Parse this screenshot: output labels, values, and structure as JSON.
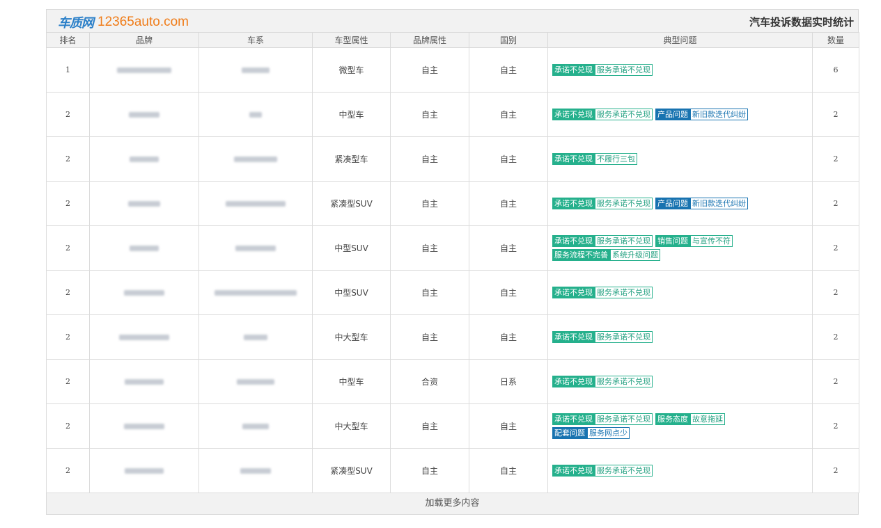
{
  "header": {
    "logo_text": "车质网",
    "logo_url": "12365auto.com",
    "title": "汽车投诉数据实时统计"
  },
  "columns": [
    "排名",
    "品牌",
    "车系",
    "车型属性",
    "品牌属性",
    "国别",
    "典型问题",
    "数量"
  ],
  "rows": [
    {
      "rank": "1",
      "type": "微型车",
      "brand_attr": "自主",
      "country": "自主",
      "count": "6",
      "lines": [
        [
          {
            "text": "承诺不兑现",
            "kind": "cat",
            "color": "green"
          },
          {
            "text": "服务承诺不兑现",
            "kind": "sub",
            "color": "green"
          }
        ]
      ]
    },
    {
      "rank": "2",
      "type": "中型车",
      "brand_attr": "自主",
      "country": "自主",
      "count": "2",
      "lines": [
        [
          {
            "text": "承诺不兑现",
            "kind": "cat",
            "color": "green"
          },
          {
            "text": "服务承诺不兑现",
            "kind": "sub",
            "color": "green"
          },
          {
            "text": "产品问题",
            "kind": "cat",
            "color": "blue"
          },
          {
            "text": "新旧款迭代纠纷",
            "kind": "sub",
            "color": "blue"
          }
        ]
      ]
    },
    {
      "rank": "2",
      "type": "紧凑型车",
      "brand_attr": "自主",
      "country": "自主",
      "count": "2",
      "lines": [
        [
          {
            "text": "承诺不兑现",
            "kind": "cat",
            "color": "green"
          },
          {
            "text": "不履行三包",
            "kind": "sub",
            "color": "green"
          }
        ]
      ]
    },
    {
      "rank": "2",
      "type": "紧凑型SUV",
      "brand_attr": "自主",
      "country": "自主",
      "count": "2",
      "lines": [
        [
          {
            "text": "承诺不兑现",
            "kind": "cat",
            "color": "green"
          },
          {
            "text": "服务承诺不兑现",
            "kind": "sub",
            "color": "green"
          },
          {
            "text": "产品问题",
            "kind": "cat",
            "color": "blue"
          },
          {
            "text": "新旧款迭代纠纷",
            "kind": "sub",
            "color": "blue"
          }
        ]
      ]
    },
    {
      "rank": "2",
      "type": "中型SUV",
      "brand_attr": "自主",
      "country": "自主",
      "count": "2",
      "lines": [
        [
          {
            "text": "承诺不兑现",
            "kind": "cat",
            "color": "green"
          },
          {
            "text": "服务承诺不兑现",
            "kind": "sub",
            "color": "green"
          },
          {
            "text": "销售问题",
            "kind": "cat",
            "color": "green"
          },
          {
            "text": "与宣传不符",
            "kind": "sub",
            "color": "green"
          }
        ],
        [
          {
            "text": "服务流程不完善",
            "kind": "cat",
            "color": "green"
          },
          {
            "text": "系统升级问题",
            "kind": "sub",
            "color": "green"
          }
        ]
      ]
    },
    {
      "rank": "2",
      "type": "中型SUV",
      "brand_attr": "自主",
      "country": "自主",
      "count": "2",
      "lines": [
        [
          {
            "text": "承诺不兑现",
            "kind": "cat",
            "color": "green"
          },
          {
            "text": "服务承诺不兑现",
            "kind": "sub",
            "color": "green"
          }
        ]
      ]
    },
    {
      "rank": "2",
      "type": "中大型车",
      "brand_attr": "自主",
      "country": "自主",
      "count": "2",
      "lines": [
        [
          {
            "text": "承诺不兑现",
            "kind": "cat",
            "color": "green"
          },
          {
            "text": "服务承诺不兑现",
            "kind": "sub",
            "color": "green"
          }
        ]
      ]
    },
    {
      "rank": "2",
      "type": "中型车",
      "brand_attr": "合资",
      "country": "日系",
      "count": "2",
      "lines": [
        [
          {
            "text": "承诺不兑现",
            "kind": "cat",
            "color": "green"
          },
          {
            "text": "服务承诺不兑现",
            "kind": "sub",
            "color": "green"
          }
        ]
      ]
    },
    {
      "rank": "2",
      "type": "中大型车",
      "brand_attr": "自主",
      "country": "自主",
      "count": "2",
      "lines": [
        [
          {
            "text": "承诺不兑现",
            "kind": "cat",
            "color": "green"
          },
          {
            "text": "服务承诺不兑现",
            "kind": "sub",
            "color": "green"
          },
          {
            "text": "服务态度",
            "kind": "cat",
            "color": "green"
          },
          {
            "text": "故意拖延",
            "kind": "sub",
            "color": "green"
          }
        ],
        [
          {
            "text": "配套问题",
            "kind": "cat",
            "color": "blue"
          },
          {
            "text": "服务网点少",
            "kind": "sub",
            "color": "blue"
          }
        ]
      ]
    },
    {
      "rank": "2",
      "type": "紧凑型SUV",
      "brand_attr": "自主",
      "country": "自主",
      "count": "2",
      "lines": [
        [
          {
            "text": "承诺不兑现",
            "kind": "cat",
            "color": "green"
          },
          {
            "text": "服务承诺不兑现",
            "kind": "sub",
            "color": "green"
          }
        ]
      ]
    }
  ],
  "footer": {
    "load_more": "加载更多内容"
  },
  "colors": {
    "green": "#25b08c",
    "blue": "#1873b0",
    "logo_blue": "#2a7fc8",
    "logo_orange": "#f07d1a"
  }
}
